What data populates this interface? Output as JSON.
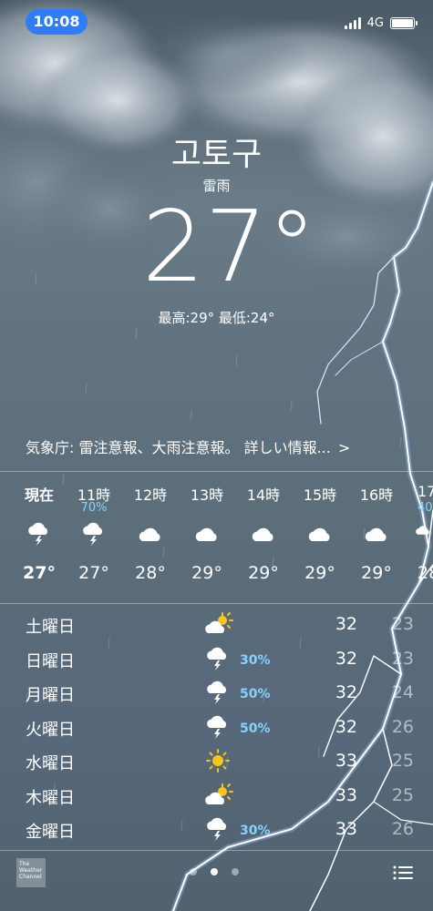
{
  "status_bar": {
    "time": "10:08",
    "network": "4G"
  },
  "location": {
    "city": "고토구",
    "condition": "雷雨",
    "temperature": "27°",
    "hi_lo": "最高:29° 最低:24°"
  },
  "alert": {
    "text": "気象庁: 雷注意報、大雨注意報。 詳しい情報...",
    "chevron": ">"
  },
  "hourly": [
    {
      "label": "現在",
      "pct": "",
      "icon": "thunder-icon",
      "temp": "27°"
    },
    {
      "label": "11時",
      "pct": "70%",
      "icon": "thunder-icon",
      "temp": "27°"
    },
    {
      "label": "12時",
      "pct": "",
      "icon": "cloud-icon",
      "temp": "28°"
    },
    {
      "label": "13時",
      "pct": "",
      "icon": "cloud-icon",
      "temp": "29°"
    },
    {
      "label": "14時",
      "pct": "",
      "icon": "cloud-icon",
      "temp": "29°"
    },
    {
      "label": "15時",
      "pct": "",
      "icon": "cloud-icon",
      "temp": "29°"
    },
    {
      "label": "16時",
      "pct": "",
      "icon": "cloud-icon",
      "temp": "29°"
    },
    {
      "label": "17",
      "pct": "40",
      "icon": "thunder-icon",
      "temp": "28"
    }
  ],
  "daily": [
    {
      "day": "土曜日",
      "icon": "partly-sunny-icon",
      "pct": "",
      "hi": "32",
      "lo": "23"
    },
    {
      "day": "日曜日",
      "icon": "thunder-icon",
      "pct": "30%",
      "hi": "32",
      "lo": "23"
    },
    {
      "day": "月曜日",
      "icon": "thunder-icon",
      "pct": "50%",
      "hi": "32",
      "lo": "24"
    },
    {
      "day": "火曜日",
      "icon": "thunder-icon",
      "pct": "50%",
      "hi": "32",
      "lo": "26"
    },
    {
      "day": "水曜日",
      "icon": "sun-icon",
      "pct": "",
      "hi": "33",
      "lo": "25"
    },
    {
      "day": "木曜日",
      "icon": "partly-sunny-icon",
      "pct": "",
      "hi": "33",
      "lo": "25"
    },
    {
      "day": "金曜日",
      "icon": "thunder-icon",
      "pct": "30%",
      "hi": "33",
      "lo": "26"
    }
  ],
  "footer": {
    "logo_text": "The Weather Channel",
    "pages": 3,
    "active_page": 2
  },
  "colors": {
    "time_pill": "#2f7cf6",
    "precip": "#86d2ff",
    "sun": "#f5c518"
  }
}
